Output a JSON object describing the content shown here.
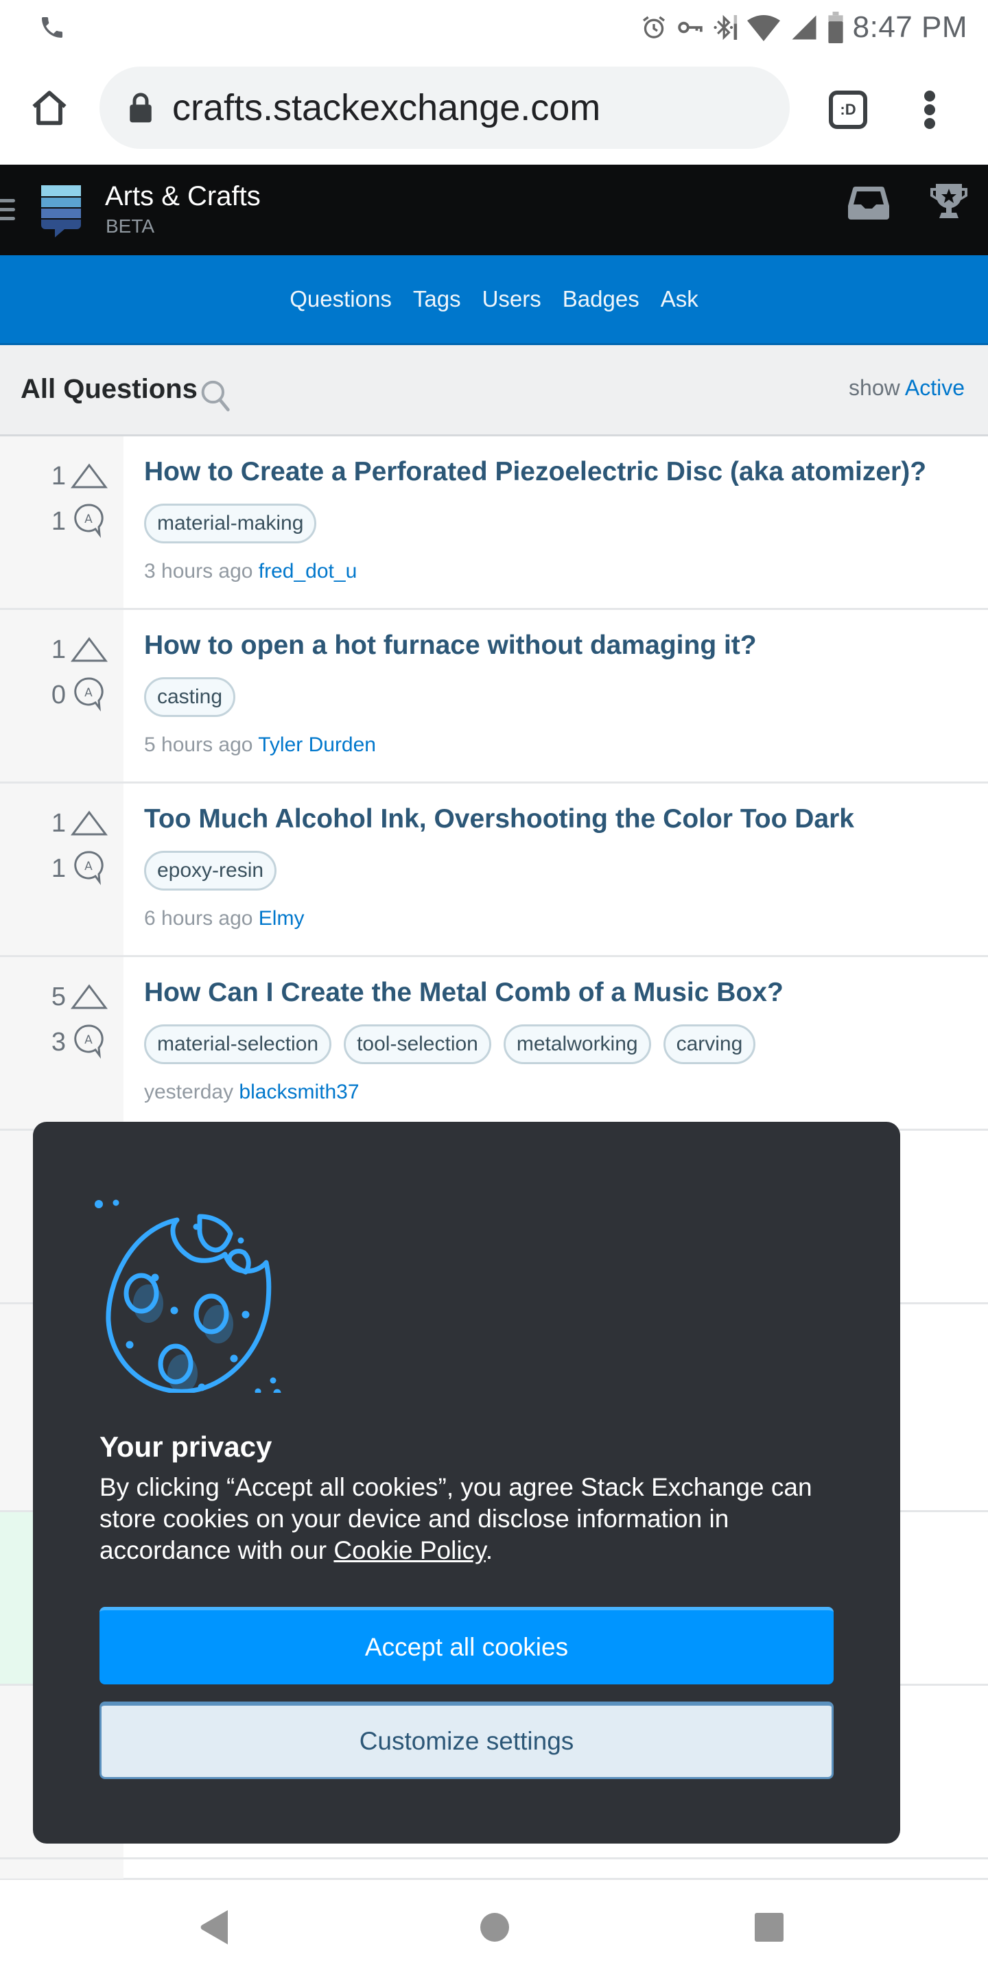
{
  "status_bar": {
    "time": "8:47 PM",
    "left_icons": [
      "phone-icon"
    ],
    "right_icons": [
      "alarm-icon",
      "vpn-key-icon",
      "bluetooth-icon",
      "wifi-icon",
      "signal-icon",
      "battery-icon"
    ]
  },
  "browser": {
    "url": "crafts.stackexchange.com",
    "tab_switcher_label": ":D",
    "icons": [
      "home-icon",
      "lock-icon",
      "tab-switcher-icon",
      "overflow-menu-icon"
    ]
  },
  "site_header": {
    "title": "Arts & Crafts",
    "subtitle": "BETA",
    "icons": [
      "hamburger-icon",
      "site-logo",
      "inbox-icon",
      "achievements-trophy-icon"
    ]
  },
  "nav": {
    "items": [
      {
        "label": "Questions"
      },
      {
        "label": "Tags"
      },
      {
        "label": "Users"
      },
      {
        "label": "Badges"
      },
      {
        "label": "Ask"
      }
    ]
  },
  "questions_header": {
    "title": "All Questions",
    "show_label": "show",
    "show_value": "Active"
  },
  "questions": [
    {
      "votes": "1",
      "answers": "1",
      "title": "How to Create a Perforated Piezoelectric Disc (aka atomizer)?",
      "tags": [
        "material-making"
      ],
      "time": "3 hours ago",
      "user": "fred_dot_u"
    },
    {
      "votes": "1",
      "answers": "0",
      "title": "How to open a hot furnace without damaging it?",
      "tags": [
        "casting"
      ],
      "time": "5 hours ago",
      "user": "Tyler Durden"
    },
    {
      "votes": "1",
      "answers": "1",
      "title": "Too Much Alcohol Ink, Overshooting the Color Too Dark",
      "tags": [
        "epoxy-resin"
      ],
      "time": "6 hours ago",
      "user": "Elmy"
    },
    {
      "votes": "5",
      "answers": "3",
      "title": "How Can I Create the Metal Comb of a Music Box?",
      "tags": [
        "material-selection",
        "tool-selection",
        "metalworking",
        "carving"
      ],
      "time": "yesterday",
      "user": "blacksmith37"
    }
  ],
  "cookie_dialog": {
    "heading": "Your privacy",
    "body_before_link": "By clicking “Accept all cookies”, you agree Stack Exchange can store cookies on your device and disclose information in accordance with our ",
    "link_text": "Cookie Policy",
    "body_after_link": ".",
    "accept_label": "Accept all cookies",
    "customize_label": "Customize settings",
    "colors": {
      "background": "#2f3237",
      "accent": "#0095ff",
      "secondary_bg": "#e1ecf4"
    }
  },
  "android_nav": {
    "icons": [
      "back-icon",
      "home-circle-icon",
      "recents-icon"
    ]
  },
  "colors": {
    "nav_blue": "#0077cc",
    "header_black": "#0c0d0e",
    "question_title": "#2c5777",
    "link": "#0077cc"
  }
}
